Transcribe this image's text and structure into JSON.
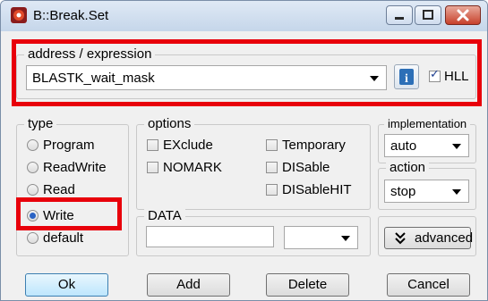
{
  "window": {
    "title": "B::Break.Set"
  },
  "address": {
    "legend": "address / expression",
    "value": "BLASTK_wait_mask",
    "hll_label": "HLL",
    "hll_checked": true
  },
  "type_group": {
    "legend": "type",
    "options": [
      "Program",
      "ReadWrite",
      "Read",
      "Write",
      "default"
    ],
    "selected": "Write"
  },
  "options_group": {
    "legend": "options",
    "left": [
      "EXclude",
      "NOMARK"
    ],
    "right": [
      "Temporary",
      "DISable",
      "DISableHIT"
    ]
  },
  "data_group": {
    "legend": "DATA",
    "value": "",
    "select_value": ""
  },
  "implementation_group": {
    "legend": "implementation",
    "value": "auto"
  },
  "action_group": {
    "legend": "action",
    "value": "stop"
  },
  "advanced_button": {
    "label": "advanced",
    "icon": "double-chevron-down-icon"
  },
  "buttons": {
    "ok": "Ok",
    "add": "Add",
    "delete": "Delete",
    "cancel": "Cancel"
  },
  "colors": {
    "highlight": "#e8000b",
    "selected_radio": "#2a63c4"
  }
}
